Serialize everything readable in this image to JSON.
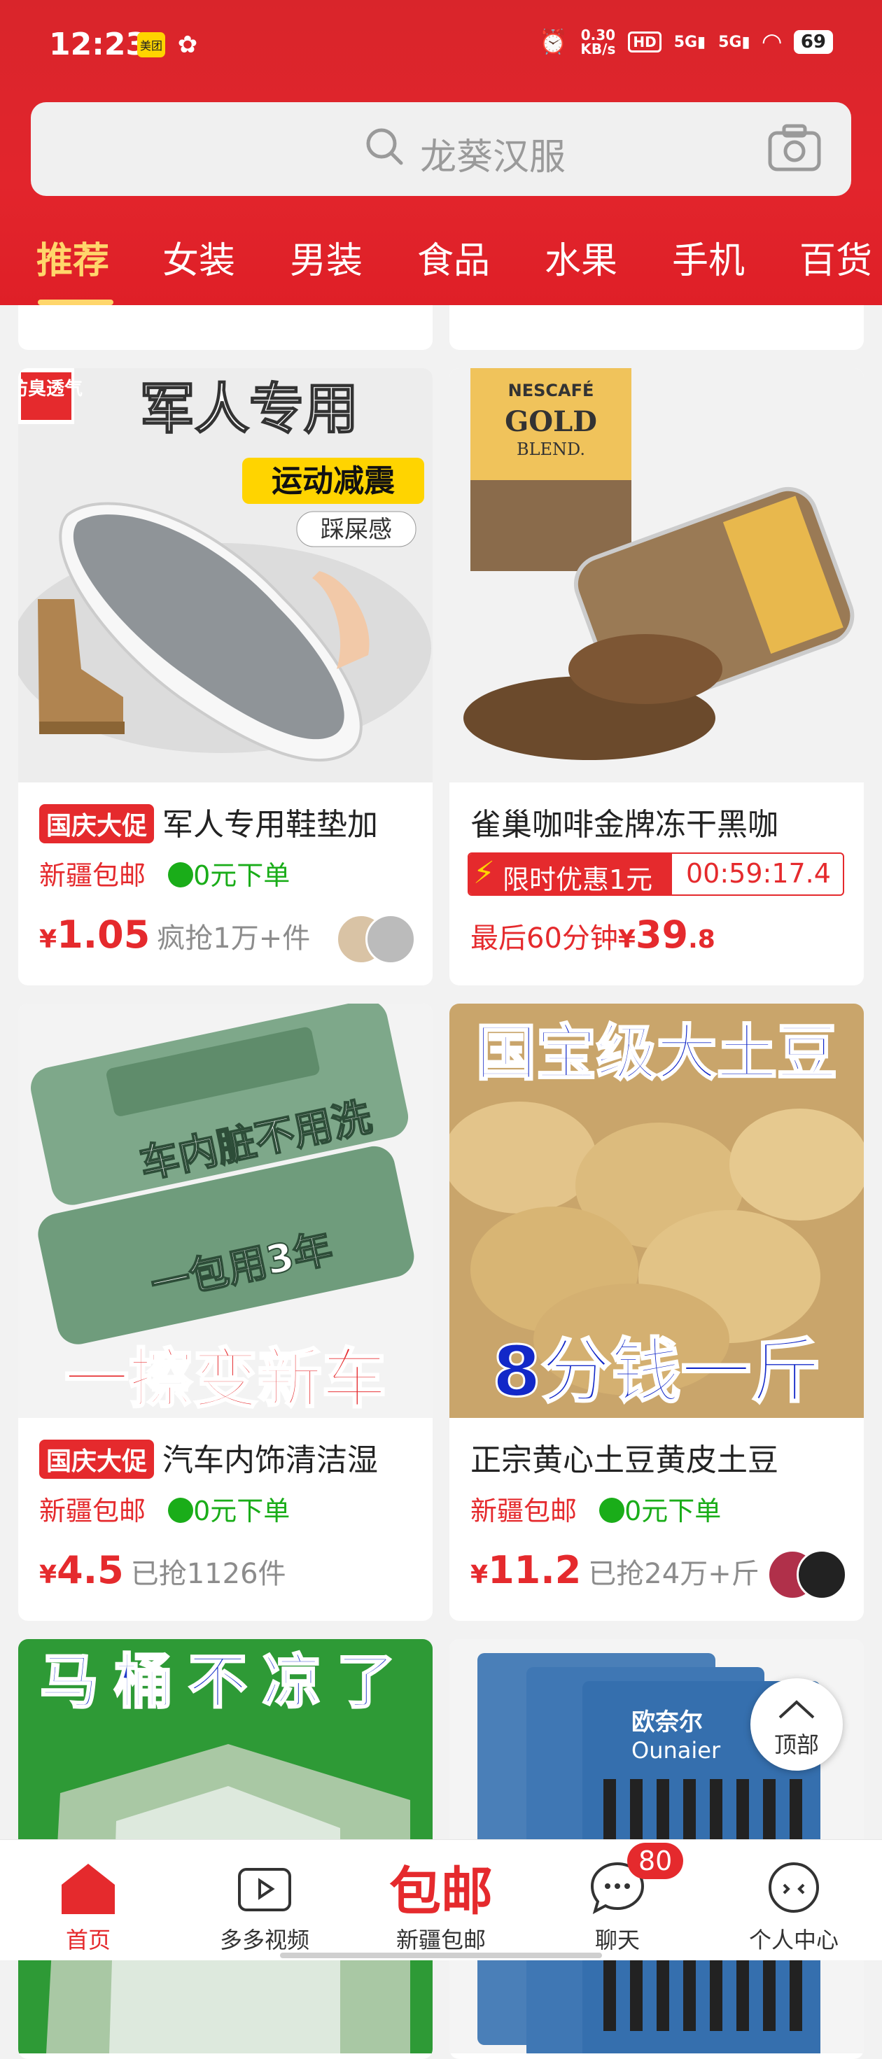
{
  "status_bar": {
    "time": "12:23",
    "speed_value": "0.30",
    "speed_unit": "KB/s",
    "battery": "69",
    "meituan_label": "美团"
  },
  "search": {
    "placeholder": "龙葵汉服"
  },
  "tabs": [
    {
      "label": "推荐",
      "active": true
    },
    {
      "label": "女装"
    },
    {
      "label": "男装"
    },
    {
      "label": "食品"
    },
    {
      "label": "水果"
    },
    {
      "label": "手机"
    },
    {
      "label": "百货"
    }
  ],
  "products": [
    {
      "title": "军人专用鞋垫加",
      "promo": "国庆大促",
      "shipping": "新疆包邮",
      "zero_order": "0元下单",
      "price_symbol": "¥",
      "price": "1.05",
      "sold": "疯抢1万+件",
      "image_text": {
        "badge": "防臭透气",
        "headline": "军人专用",
        "ribbon": "运动减震",
        "tag": "踩屎感"
      }
    },
    {
      "title": "雀巢咖啡金牌冻干黑咖",
      "flash_label": "限时优惠1元",
      "countdown": "00:59:17.4",
      "last_label": "最后60分钟",
      "price_symbol": "¥",
      "price_int": "39",
      "price_dec": ".8",
      "image_text": {
        "brand": "NESCAFÉ",
        "sub": "GOLD",
        "sub2": "BLEND."
      }
    },
    {
      "title": "汽车内饰清洁湿",
      "promo": "国庆大促",
      "shipping": "新疆包邮",
      "zero_order": "0元下单",
      "price_symbol": "¥",
      "price": "4.5",
      "sold": "已抢1126件",
      "image_text": {
        "line1": "车内脏不用洗",
        "line2": "一包用3年",
        "bottom": "一擦变新车"
      }
    },
    {
      "title": "正宗黄心土豆黄皮土豆",
      "shipping": "新疆包邮",
      "zero_order": "0元下单",
      "price_symbol": "¥",
      "price": "11.2",
      "sold": "已抢24万+斤",
      "image_text": {
        "top": "国宝级大土豆",
        "bottom": "8分钱一斤"
      }
    },
    {
      "image_text": {
        "top": "马桶不凉了"
      }
    },
    {
      "image_text": {
        "brand": "欧奈尔",
        "brand_en": "Ounaier"
      }
    }
  ],
  "back_to_top": {
    "label": "顶部"
  },
  "bottom_nav": [
    {
      "label": "首页",
      "active": true
    },
    {
      "label": "多多视频"
    },
    {
      "label": "新疆包邮",
      "banner": "包邮"
    },
    {
      "label": "聊天",
      "badge": "80"
    },
    {
      "label": "个人中心"
    }
  ],
  "colors": {
    "brand_red": "#e2252c",
    "active_tab": "#ffd66b",
    "price_red": "#e52a2d",
    "green": "#1aad19"
  }
}
